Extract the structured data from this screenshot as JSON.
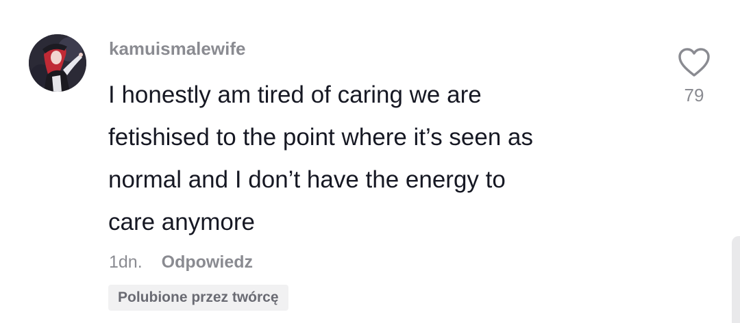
{
  "comment": {
    "username": "kamuismalewife",
    "text": "I honestly am tired of caring we are\nfetishised to the point where it’s seen as\nnormal and I don’t have the energy to\ncare anymore",
    "timestamp": "1dn.",
    "reply_label": "Odpowiedz",
    "creator_badge": "Polubione przez twórcę",
    "likes": "79"
  },
  "icons": {
    "like": "heart-icon",
    "avatar": "avatar"
  },
  "colors": {
    "text": "#161823",
    "secondary": "#8a8b91",
    "badge_bg": "#f1f1f2"
  }
}
